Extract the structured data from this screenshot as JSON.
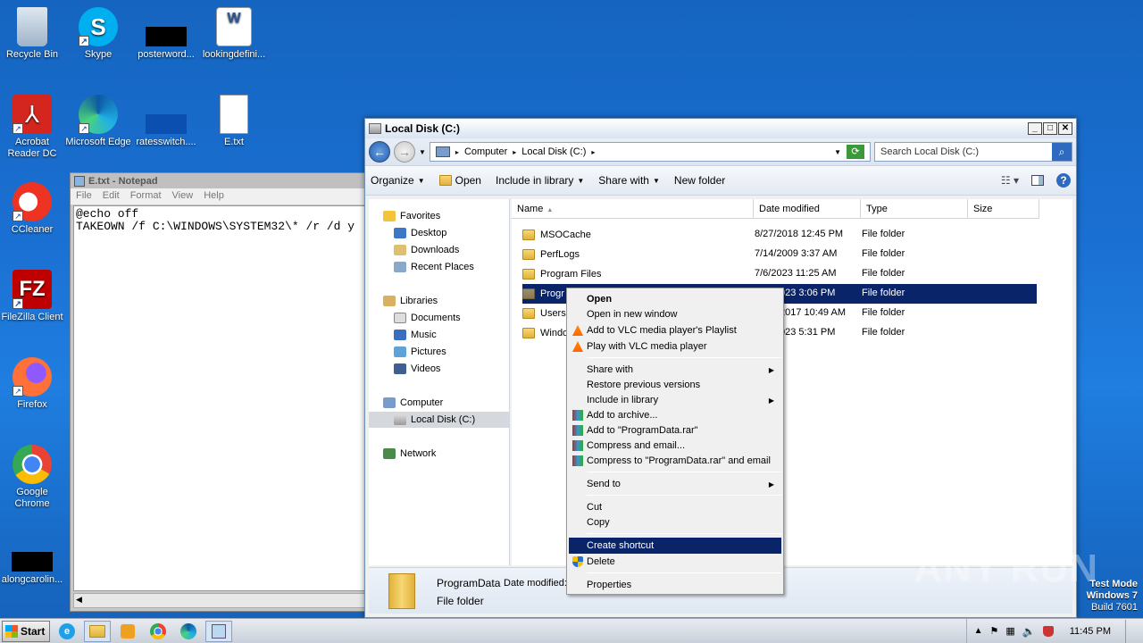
{
  "desktop": {
    "icons": [
      {
        "label": "Recycle Bin"
      },
      {
        "label": "Skype"
      },
      {
        "label": "posterword..."
      },
      {
        "label": "lookingdefini..."
      },
      {
        "label": "Acrobat Reader DC"
      },
      {
        "label": "Microsoft Edge"
      },
      {
        "label": "ratesswitch...."
      },
      {
        "label": "E.txt"
      },
      {
        "label": "CCleaner"
      },
      {
        "label": "FileZilla Client"
      },
      {
        "label": "Firefox"
      },
      {
        "label": "Google Chrome"
      },
      {
        "label": "alongcarolin..."
      }
    ]
  },
  "notepad": {
    "title": "E.txt - Notepad",
    "menu": [
      "File",
      "Edit",
      "Format",
      "View",
      "Help"
    ],
    "content": "@echo off\nTAKEOWN /f C:\\WINDOWS\\SYSTEM32\\* /r /d y"
  },
  "explorer": {
    "title": "Local Disk (C:)",
    "breadcrumb": [
      "Computer",
      "Local Disk (C:)"
    ],
    "search_placeholder": "Search Local Disk (C:)",
    "toolbar": {
      "organize": "Organize",
      "open": "Open",
      "include": "Include in library",
      "share": "Share with",
      "new_folder": "New folder"
    },
    "nav": {
      "favorites": "Favorites",
      "desktop": "Desktop",
      "downloads": "Downloads",
      "recent": "Recent Places",
      "libraries": "Libraries",
      "documents": "Documents",
      "music": "Music",
      "pictures": "Pictures",
      "videos": "Videos",
      "computer": "Computer",
      "localdisk": "Local Disk (C:)",
      "network": "Network"
    },
    "columns": {
      "name": "Name",
      "date": "Date modified",
      "type": "Type",
      "size": "Size"
    },
    "files": [
      {
        "name": "MSOCache",
        "date": "8/27/2018 12:45 PM",
        "type": "File folder"
      },
      {
        "name": "PerfLogs",
        "date": "7/14/2009 3:37 AM",
        "type": "File folder"
      },
      {
        "name": "Program Files",
        "date": "7/6/2023 11:25 AM",
        "type": "File folder"
      },
      {
        "name": "Progr",
        "date": "023 3:06 PM",
        "type": "File folder"
      },
      {
        "name": "Users",
        "date": "2017 10:49 AM",
        "type": "File folder"
      },
      {
        "name": "Windo",
        "date": "023 5:31 PM",
        "type": "File folder"
      }
    ],
    "details": {
      "name": "ProgramData",
      "date_label": "Date modified:",
      "type": "File folder"
    }
  },
  "context_menu": {
    "items": [
      "Open",
      "Open in new window",
      "Add to VLC media player's Playlist",
      "Play with VLC media player",
      "Share with",
      "Restore previous versions",
      "Include in library",
      "Add to archive...",
      "Add to \"ProgramData.rar\"",
      "Compress and email...",
      "Compress to \"ProgramData.rar\" and email",
      "Send to",
      "Cut",
      "Copy",
      "Create shortcut",
      "Delete",
      "Properties"
    ]
  },
  "taskbar": {
    "start": "Start",
    "time": "11:45 PM"
  },
  "watermark": {
    "text": "ANY RUN"
  },
  "testmode": {
    "line1": "Test Mode",
    "line2": "Windows 7",
    "line3": "Build 7601"
  }
}
